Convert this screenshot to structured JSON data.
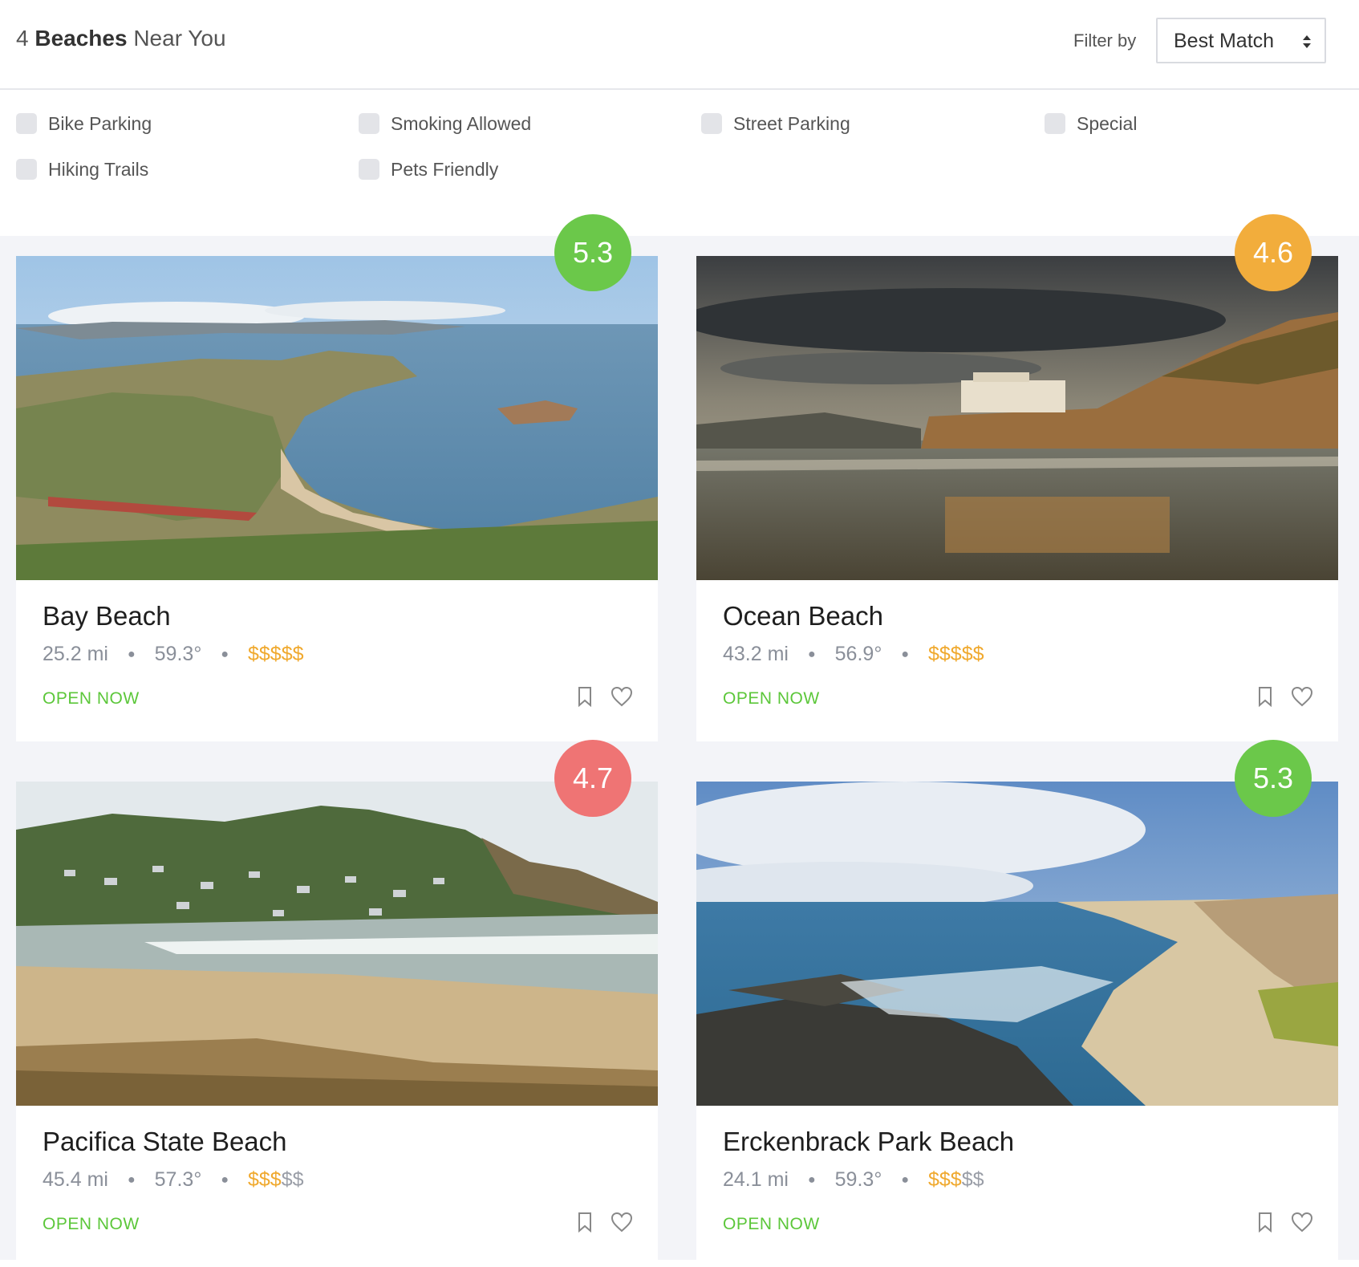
{
  "header": {
    "count": "4",
    "title_bold": "Beaches",
    "title_rest": "Near You",
    "filter_label": "Filter by",
    "sort_value": "Best Match"
  },
  "filters": [
    {
      "label": "Bike Parking",
      "checked": false
    },
    {
      "label": "Smoking Allowed",
      "checked": false
    },
    {
      "label": "Street Parking",
      "checked": false
    },
    {
      "label": "Special",
      "checked": false
    },
    {
      "label": "Hiking Trails",
      "checked": false
    },
    {
      "label": "Pets Friendly",
      "checked": false
    }
  ],
  "cards": [
    {
      "name": "Bay Beach",
      "distance": "25.2 mi",
      "temp": "59.3°",
      "price_active": "$$$$$",
      "price_inactive": "",
      "rating": "5.3",
      "rating_color": "#6bc84a",
      "status": "OPEN NOW",
      "image": "coastal-cliffs-bay"
    },
    {
      "name": "Ocean Beach",
      "distance": "43.2 mi",
      "temp": "56.9°",
      "price_active": "$$$$$",
      "price_inactive": "",
      "rating": "4.6",
      "rating_color": "#f2ad3c",
      "status": "OPEN NOW",
      "image": "cliff-house-sunset"
    },
    {
      "name": "Pacifica State Beach",
      "distance": "45.4 mi",
      "temp": "57.3°",
      "price_active": "$$$",
      "price_inactive": "$$",
      "rating": "4.7",
      "rating_color": "#ef7474",
      "status": "OPEN NOW",
      "image": "hillside-town-beach"
    },
    {
      "name": "Erckenbrack Park Beach",
      "distance": "24.1 mi",
      "temp": "59.3°",
      "price_active": "$$$",
      "price_inactive": "$$",
      "rating": "5.3",
      "rating_color": "#6bc84a",
      "status": "OPEN NOW",
      "image": "sandy-cove-waves"
    }
  ]
}
